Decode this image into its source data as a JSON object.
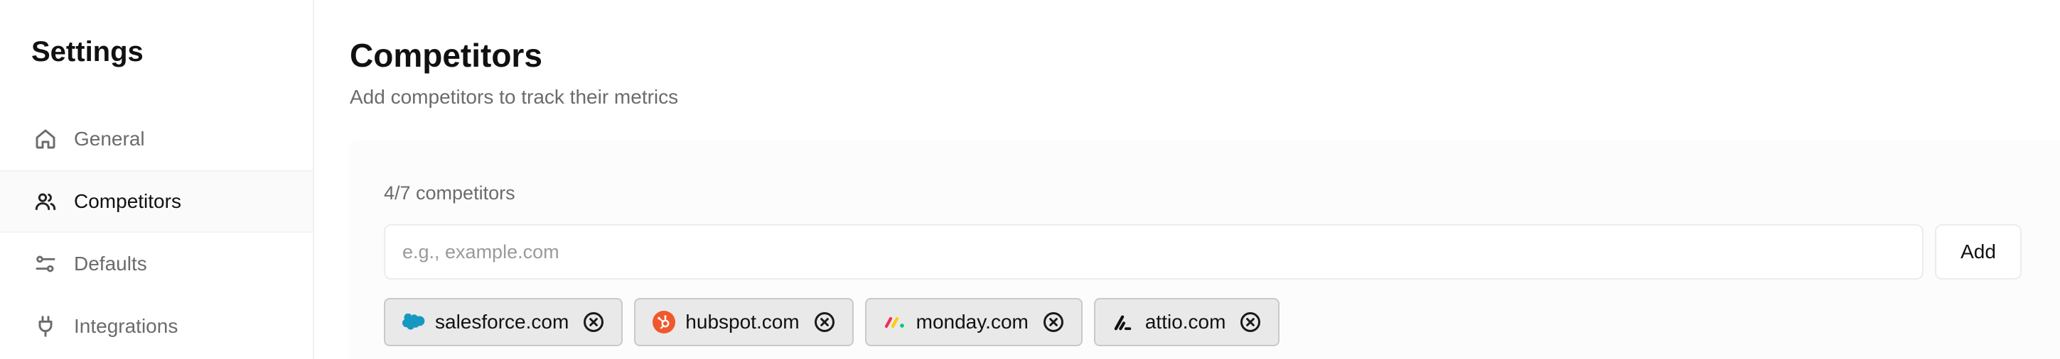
{
  "sidebar": {
    "title": "Settings",
    "items": [
      {
        "label": "General",
        "icon": "home-icon",
        "active": false
      },
      {
        "label": "Competitors",
        "icon": "users-icon",
        "active": true
      },
      {
        "label": "Defaults",
        "icon": "sliders-icon",
        "active": false
      },
      {
        "label": "Integrations",
        "icon": "plug-icon",
        "active": false
      }
    ]
  },
  "main": {
    "title": "Competitors",
    "subtitle": "Add competitors to track their metrics",
    "count_label": "4/7 competitors",
    "input": {
      "placeholder": "e.g., example.com",
      "value": ""
    },
    "add_label": "Add",
    "competitors": [
      {
        "domain": "salesforce.com",
        "logo": "salesforce-logo-icon"
      },
      {
        "domain": "hubspot.com",
        "logo": "hubspot-logo-icon"
      },
      {
        "domain": "monday.com",
        "logo": "monday-logo-icon"
      },
      {
        "domain": "attio.com",
        "logo": "attio-logo-icon"
      }
    ]
  },
  "colors": {
    "salesforce": "#1798c1",
    "hubspot": "#f0582c",
    "monday_red": "#f62b54",
    "monday_yellow": "#ffcc00",
    "monday_green": "#00ca72"
  }
}
